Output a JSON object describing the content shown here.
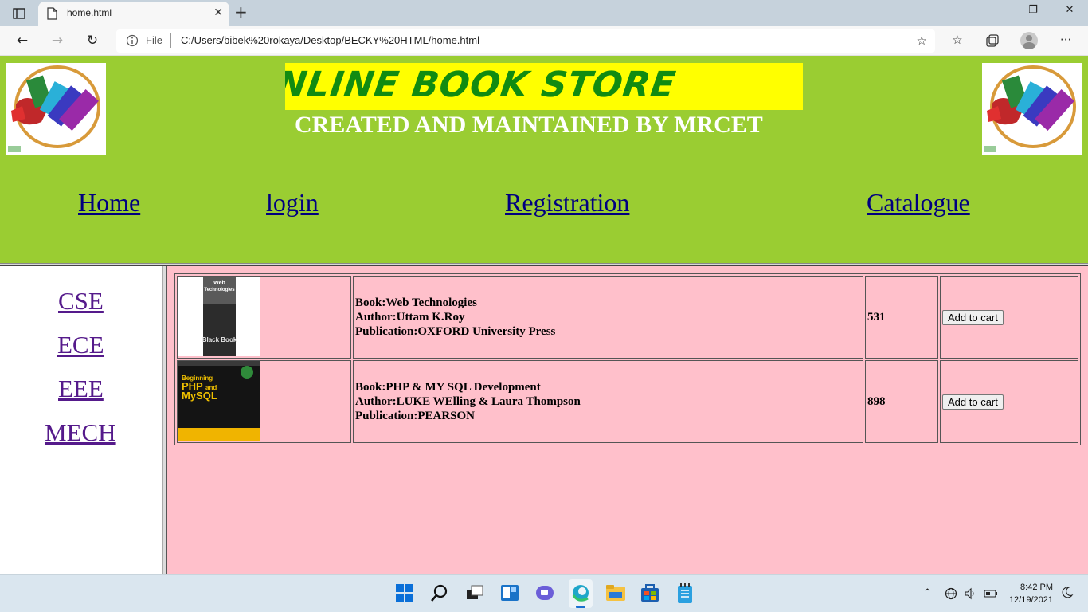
{
  "browser": {
    "tab_title": "home.html",
    "tab_close": "✕",
    "new_tab": "+",
    "window_controls": {
      "minimize": "—",
      "restore": "❐",
      "close": "✕"
    },
    "back": "←",
    "forward": "→",
    "reload": "↻",
    "scheme_label": "File",
    "url": "C:/Users/bibek%20rokaya/Desktop/BECKY%20HTML/home.html",
    "more": "···"
  },
  "header": {
    "banner_text": "NLINE BOOK STORE",
    "subtitle": "CREATED AND MAINTAINED BY MRCET",
    "brand_color": "#9acd32",
    "banner_bg": "#ffff00",
    "banner_text_color": "#118b11"
  },
  "nav": {
    "home": "Home",
    "login": "login",
    "registration": "Registration",
    "catalogue": "Catalogue"
  },
  "departments": [
    "CSE",
    "ECE",
    "EEE",
    "MECH"
  ],
  "catalogue": {
    "background": "#ffc0cb",
    "books": [
      {
        "cover": "Web Technologies Black Book",
        "cover_lines": [
          "Web",
          "Technologies",
          "Black Book"
        ],
        "book": "Book:Web Technologies",
        "author": "Author:Uttam K.Roy",
        "publication": "Publication:OXFORD University Press",
        "price": "531",
        "button": "Add to cart"
      },
      {
        "cover": "Beginning PHP and MySQL",
        "cover_lines": [
          "Beginning",
          "PHP",
          "and",
          "MySQL"
        ],
        "book": "Book:PHP & MY SQL Development",
        "author": "Author:LUKE WElling & Laura Thompson",
        "publication": "Publication:PEARSON",
        "price": "898",
        "button": "Add to cart"
      }
    ]
  },
  "taskbar": {
    "time": "8:42 PM",
    "date": "12/19/2021"
  }
}
